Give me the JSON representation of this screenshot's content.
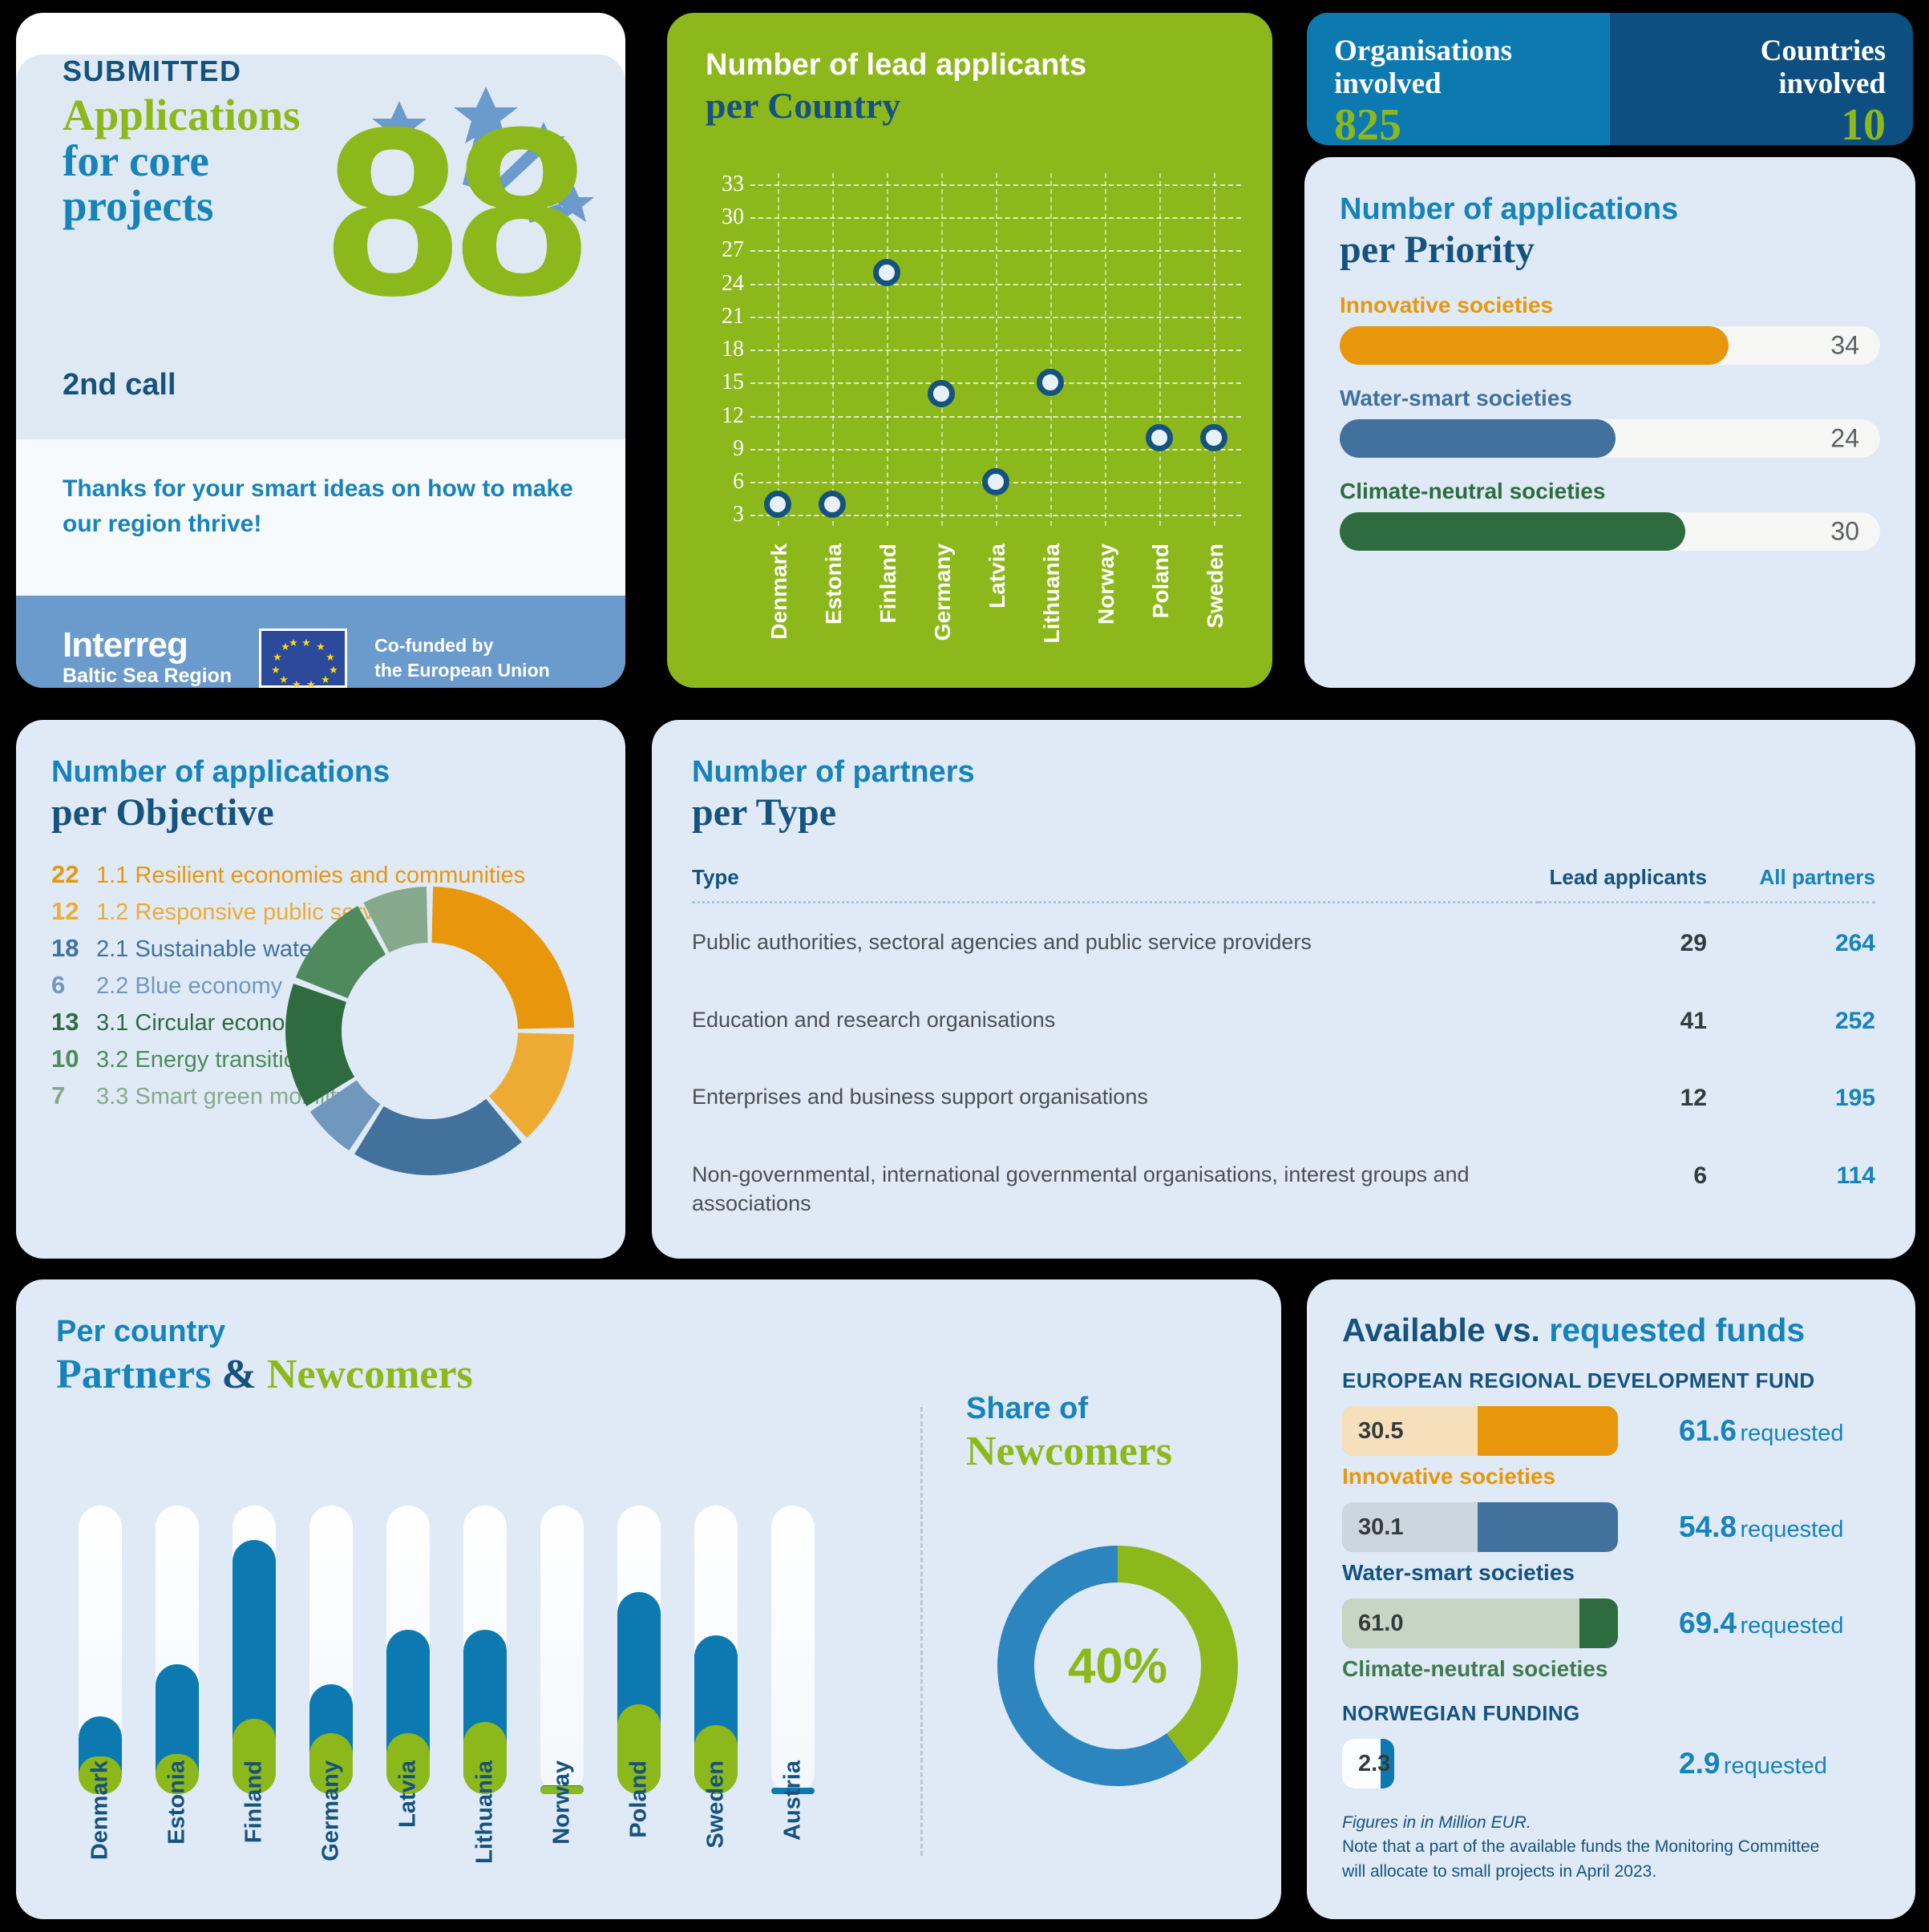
{
  "colors": {
    "green": "#8cb81c",
    "blue_mid": "#1683ba",
    "blue_dark": "#16527e",
    "blue_brand": "#0c7ab0",
    "orange": "#e8970c",
    "orange_lt": "#eeab33",
    "steel": "#41719c",
    "steel_lt": "#7097bd",
    "forest": "#2e6b3f",
    "sage": "#86a98b",
    "sage2": "#4e8a5c",
    "pale": "#dfeaf6"
  },
  "hero": {
    "kicker": "SUBMITTED",
    "title_line1": "Applications",
    "title_line2": "for core",
    "title_line3": "projects",
    "call": "2nd call",
    "big_number": "88",
    "thanks": "Thanks for your smart ideas on how to make our region thrive!",
    "brand_name": "Interreg",
    "brand_sub": "Baltic Sea Region",
    "cofunded_line1": "Co-funded by",
    "cofunded_line2": "the European Union"
  },
  "scatter": {
    "title_small": "Number of lead applicants",
    "title_large": "per Country"
  },
  "stats": {
    "organisations_label_l1": "Organisations",
    "organisations_label_l2": "involved",
    "organisations_value": "825",
    "countries_label_l1": "Countries",
    "countries_label_l2": "involved",
    "countries_value": "10"
  },
  "priority": {
    "title_small": "Number of applications",
    "title_large": "per Priority",
    "items": [
      {
        "label": "Innovative societies",
        "value": "34",
        "color": "#e8970c",
        "pct": 72
      },
      {
        "label": "Water-smart societies",
        "value": "24",
        "color": "#41719c",
        "pct": 51
      },
      {
        "label": "Climate-neutral societies",
        "value": "30",
        "color": "#2e6b3f",
        "pct": 64
      }
    ]
  },
  "objective": {
    "title_small": "Number of applications",
    "title_large": "per Objective",
    "items": [
      {
        "count": "22",
        "label": "1.1 Resilient economies and communities",
        "color": "#e8970c"
      },
      {
        "count": "12",
        "label": "1.2 Responsive public services",
        "color": "#eeab33"
      },
      {
        "count": "18",
        "label": "2.1 Sustainable waters",
        "color": "#41719c"
      },
      {
        "count": "6",
        "label": "2.2 Blue economy",
        "color": "#7097bd"
      },
      {
        "count": "13",
        "label": "3.1 Circular economy",
        "color": "#2e6b3f"
      },
      {
        "count": "10",
        "label": "3.2 Energy transition",
        "color": "#4e8a5c"
      },
      {
        "count": "7",
        "label": "3.3 Smart green mobility",
        "color": "#86a98b"
      }
    ]
  },
  "partner_type": {
    "title_small": "Number of partners",
    "title_large": "per Type",
    "columns": [
      "Type",
      "Lead applicants",
      "All partners"
    ],
    "rows": [
      {
        "type": "Public authorities, sectoral agencies and public service providers",
        "lead": "29",
        "all": "264"
      },
      {
        "type": "Education and research organisations",
        "lead": "41",
        "all": "252"
      },
      {
        "type": "Enterprises and business support organisations",
        "lead": "12",
        "all": "195"
      },
      {
        "type": "Non-governmental, international governmental organisations, interest groups and associations",
        "lead": "6",
        "all": "114"
      }
    ]
  },
  "partners_newcomers": {
    "title_small": "Per country",
    "title_partners": "Partners",
    "title_amp": "&",
    "title_newcomers": "Newcomers",
    "share_title_small": "Share of",
    "share_title_large": "Newcomers",
    "share_value": "40%"
  },
  "funds": {
    "title_a": "Available vs.",
    "title_b": " requested funds",
    "section_erdf": "EUROPEAN REGIONAL DEVELOPMENT FUND",
    "section_norway": "NORWEGIAN FUNDING",
    "requested_word": "requested",
    "items": [
      {
        "available": "30.5",
        "requested": "61.6",
        "label": "Innovative societies",
        "color": "#e8970c",
        "avail_bg": "#f6e0ba",
        "label_color": "#e8970c",
        "avail_pct": 49,
        "req_pct": 100
      },
      {
        "available": "30.1",
        "requested": "54.8",
        "label": "Water-smart societies",
        "color": "#41719c",
        "avail_bg": "#ccd6de",
        "label_color": "#16527e",
        "avail_pct": 49,
        "req_pct": 100
      },
      {
        "available": "61.0",
        "requested": "69.4",
        "label": "Climate-neutral societies",
        "color": "#2e6b3f",
        "avail_bg": "#c7d6c2",
        "label_color": "#3f7a4d",
        "avail_pct": 86,
        "req_pct": 100
      }
    ],
    "norway": {
      "available": "2.3",
      "requested": "2.9",
      "color": "#0c7ab0",
      "avail_bg": "#fbfdff",
      "avail_pct": 14,
      "req_pct": 19
    },
    "note_italic": "Figures in in Million EUR.",
    "note_line1": "Note that a part of the available funds the Monitoring Committee",
    "note_line2": "will allocate to small projects in April 2023."
  },
  "chart_data": [
    {
      "type": "scatter",
      "title": "Number of lead applicants per Country",
      "xlabel": "",
      "ylabel": "",
      "categories": [
        "Denmark",
        "Estonia",
        "Finland",
        "Germany",
        "Latvia",
        "Lithuania",
        "Norway",
        "Poland",
        "Sweden"
      ],
      "values": [
        4,
        4,
        25,
        14,
        6,
        15,
        null,
        10,
        10
      ],
      "yticks": [
        3,
        6,
        9,
        12,
        15,
        18,
        21,
        24,
        27,
        30,
        33
      ],
      "ylim": [
        2,
        34
      ],
      "grid": true,
      "legend": "none"
    },
    {
      "type": "bar",
      "title": "Number of applications per Priority",
      "categories": [
        "Innovative societies",
        "Water-smart societies",
        "Climate-neutral societies"
      ],
      "values": [
        34,
        24,
        30
      ],
      "ylim": [
        0,
        47
      ],
      "orientation": "horizontal"
    },
    {
      "type": "pie",
      "title": "Number of applications per Objective",
      "categories": [
        "1.1 Resilient economies and communities",
        "1.2 Responsive public services",
        "2.1 Sustainable waters",
        "2.2 Blue economy",
        "3.1 Circular economy",
        "3.2 Energy transition",
        "3.3 Smart green mobility"
      ],
      "values": [
        22,
        12,
        18,
        6,
        13,
        10,
        7
      ],
      "colors": [
        "#e8970c",
        "#eeab33",
        "#41719c",
        "#7097bd",
        "#2e6b3f",
        "#4e8a5c",
        "#86a98b"
      ],
      "donut": true
    },
    {
      "type": "table",
      "title": "Number of partners per Type",
      "columns": [
        "Type",
        "Lead applicants",
        "All partners"
      ],
      "rows": [
        [
          "Public authorities, sectoral agencies and public service providers",
          29,
          264
        ],
        [
          "Education and research organisations",
          41,
          252
        ],
        [
          "Enterprises and business support organisations",
          12,
          195
        ],
        [
          "Non-governmental, international governmental organisations, interest groups and associations",
          6,
          114
        ]
      ]
    },
    {
      "type": "bar",
      "title": "Per country Partners & Newcomers",
      "categories": [
        "Denmark",
        "Estonia",
        "Finland",
        "Germany",
        "Latvia",
        "Lithuania",
        "Norway",
        "Poland",
        "Sweden",
        "Austria"
      ],
      "series": [
        {
          "name": "Partners",
          "values": [
            27,
            45,
            88,
            38,
            57,
            57,
            3,
            70,
            55,
            1
          ]
        },
        {
          "name": "Newcomers",
          "values": [
            13,
            14,
            26,
            21,
            21,
            25,
            2,
            31,
            24,
            0
          ]
        }
      ],
      "stacked": true,
      "ylim": [
        0,
        100
      ]
    },
    {
      "type": "pie",
      "title": "Share of Newcomers",
      "categories": [
        "Newcomers",
        "Partners"
      ],
      "values": [
        40,
        60
      ],
      "colors": [
        "#8cb81c",
        "#2d85c0"
      ],
      "donut": true,
      "center_label": "40%"
    },
    {
      "type": "bar",
      "title": "Available vs. requested funds (Million EUR)",
      "categories": [
        "Innovative societies",
        "Water-smart societies",
        "Climate-neutral societies",
        "Norwegian funding"
      ],
      "series": [
        {
          "name": "Available",
          "values": [
            30.5,
            30.1,
            61.0,
            2.3
          ]
        },
        {
          "name": "Requested",
          "values": [
            61.6,
            54.8,
            69.4,
            2.9
          ]
        }
      ],
      "orientation": "horizontal",
      "unit": "Million EUR"
    }
  ]
}
